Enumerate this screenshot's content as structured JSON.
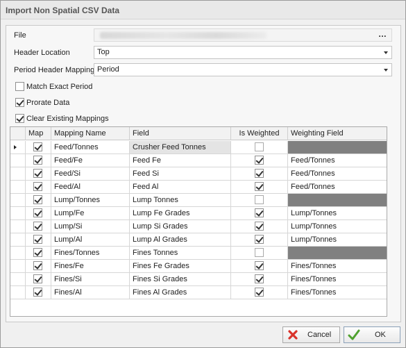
{
  "window": {
    "title": "Import Non Spatial CSV Data"
  },
  "form": {
    "file_label": "File",
    "file_button": "…",
    "header_location_label": "Header Location",
    "header_location_value": "Top",
    "period_header_label": "Period Header Mapping",
    "period_header_value": "Period",
    "match_exact_period_label": "Match Exact Period",
    "match_exact_period_checked": false,
    "prorate_data_label": "Prorate Data",
    "prorate_data_checked": true,
    "clear_mappings_label": "Clear Existing Mappings",
    "clear_mappings_checked": true
  },
  "grid": {
    "columns": [
      "Map",
      "Mapping Name",
      "Field",
      "Is Weighted",
      "Weighting Field"
    ],
    "rows": [
      {
        "map": true,
        "mapping_name": "Feed/Tonnes",
        "field": "Crusher Feed Tonnes",
        "is_weighted": false,
        "weighting_field": ""
      },
      {
        "map": true,
        "mapping_name": "Feed/Fe",
        "field": "Feed Fe",
        "is_weighted": true,
        "weighting_field": "Feed/Tonnes"
      },
      {
        "map": true,
        "mapping_name": "Feed/Si",
        "field": "Feed Si",
        "is_weighted": true,
        "weighting_field": "Feed/Tonnes"
      },
      {
        "map": true,
        "mapping_name": "Feed/Al",
        "field": "Feed Al",
        "is_weighted": true,
        "weighting_field": "Feed/Tonnes"
      },
      {
        "map": true,
        "mapping_name": "Lump/Tonnes",
        "field": "Lump Tonnes",
        "is_weighted": false,
        "weighting_field": ""
      },
      {
        "map": true,
        "mapping_name": "Lump/Fe",
        "field": "Lump Fe Grades",
        "is_weighted": true,
        "weighting_field": "Lump/Tonnes"
      },
      {
        "map": true,
        "mapping_name": "Lump/Si",
        "field": "Lump Si Grades",
        "is_weighted": true,
        "weighting_field": "Lump/Tonnes"
      },
      {
        "map": true,
        "mapping_name": "Lump/Al",
        "field": "Lump Al Grades",
        "is_weighted": true,
        "weighting_field": "Lump/Tonnes"
      },
      {
        "map": true,
        "mapping_name": "Fines/Tonnes",
        "field": "Fines Tonnes",
        "is_weighted": false,
        "weighting_field": ""
      },
      {
        "map": true,
        "mapping_name": "Fines/Fe",
        "field": "Fines Fe Grades",
        "is_weighted": true,
        "weighting_field": "Fines/Tonnes"
      },
      {
        "map": true,
        "mapping_name": "Fines/Si",
        "field": "Fines Si Grades",
        "is_weighted": true,
        "weighting_field": "Fines/Tonnes"
      },
      {
        "map": true,
        "mapping_name": "Fines/Al",
        "field": "Fines Al Grades",
        "is_weighted": true,
        "weighting_field": "Fines/Tonnes"
      }
    ]
  },
  "buttons": {
    "cancel_label": "Cancel",
    "ok_label": "OK"
  },
  "colors": {
    "cancel_icon": "#d9332b",
    "ok_icon": "#4fa12f",
    "disabled_cell": "#808080"
  }
}
